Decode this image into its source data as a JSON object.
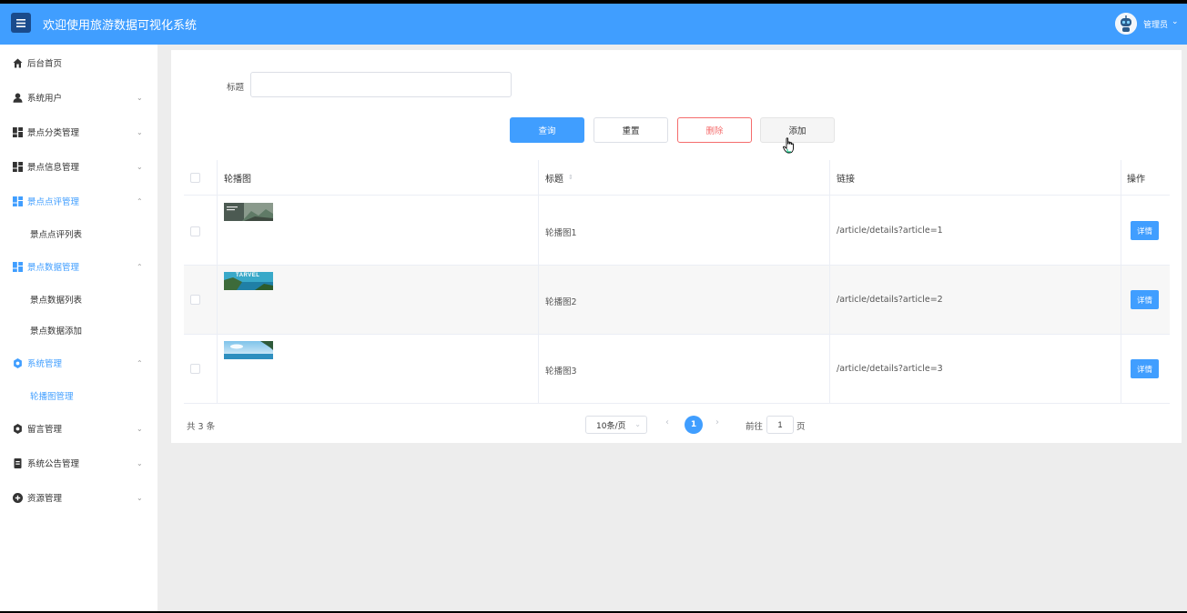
{
  "header": {
    "menu_icon": "hamburger-icon",
    "title": "欢迎使用旅游数据可视化系统",
    "user_name": "管理员",
    "user_caret": "⌄",
    "avatar_icon": "robot-avatar-icon",
    "accent_color": "#409eff"
  },
  "sidebar": {
    "items": [
      {
        "label": "后台首页",
        "icon": "home-icon"
      },
      {
        "label": "系统用户",
        "icon": "user-icon",
        "arrow": "⌄"
      },
      {
        "label": "景点分类管理",
        "icon": "grid-icon",
        "arrow": "⌄"
      },
      {
        "label": "景点信息管理",
        "icon": "grid-icon",
        "arrow": "⌄"
      },
      {
        "label": "景点点评管理",
        "icon": "grid-icon",
        "arrow": "⌃",
        "expanded": true
      },
      {
        "label": "景点数据管理",
        "icon": "grid-icon",
        "arrow": "⌃",
        "expanded": true
      },
      {
        "label": "系统管理",
        "icon": "gear-icon",
        "arrow": "⌃",
        "expanded": true
      },
      {
        "label": "留言管理",
        "icon": "gear-icon",
        "arrow": "⌄"
      },
      {
        "label": "系统公告管理",
        "icon": "document-icon",
        "arrow": "⌄"
      },
      {
        "label": "资源管理",
        "icon": "plus-circle-icon",
        "arrow": "⌄"
      }
    ],
    "sub_items": [
      {
        "label": "景点点评列表"
      },
      {
        "label": "景点数据列表"
      },
      {
        "label": "景点数据添加"
      },
      {
        "label": "轮播图管理",
        "current": true
      }
    ]
  },
  "search": {
    "label": "标题",
    "value": "",
    "placeholder": ""
  },
  "actions": {
    "query": "查询",
    "reset": "重置",
    "delete": "删除",
    "add": "添加",
    "delete_color": "#f56c6c"
  },
  "table": {
    "columns": [
      "轮播图",
      "标题",
      "链接",
      "操作"
    ],
    "sort_icon": "⇕",
    "rows": [
      {
        "title": "轮播图1",
        "link": "/article/details?article=1",
        "action": "详情",
        "thumb": "mountain-banner-thumbnail"
      },
      {
        "title": "轮播图2",
        "link": "/article/details?article=2",
        "action": "详情",
        "thumb": "travel-coast-thumbnail",
        "thumb_text": "TARVEL"
      },
      {
        "title": "轮播图3",
        "link": "/article/details?article=3",
        "action": "详情",
        "thumb": "beach-sky-thumbnail"
      }
    ]
  },
  "pagination": {
    "total": "共 3 条",
    "page_size": "10条/页",
    "page_size_caret": "⌄",
    "prev": "‹",
    "current_page": "1",
    "next": "›",
    "goto_label": "前往",
    "goto_value": "1",
    "goto_suffix": "页"
  }
}
